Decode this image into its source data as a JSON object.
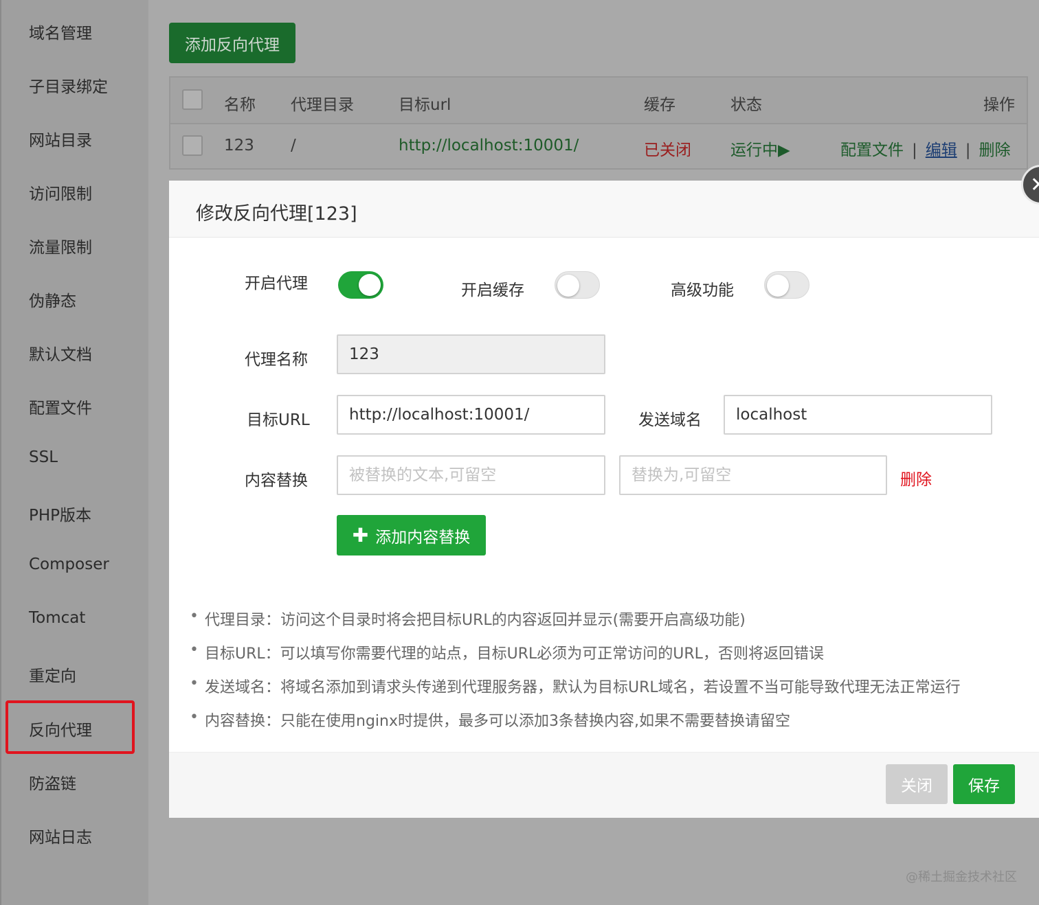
{
  "sidebar": {
    "items": [
      "域名管理",
      "子目录绑定",
      "网站目录",
      "访问限制",
      "流量限制",
      "伪静态",
      "默认文档",
      "配置文件",
      "SSL",
      "PHP版本",
      "Composer",
      "Tomcat",
      "重定向",
      "反向代理",
      "防盗链",
      "网站日志"
    ],
    "active": "反向代理"
  },
  "toolbar": {
    "add_proxy_label": "添加反向代理"
  },
  "table": {
    "headers": {
      "name": "名称",
      "dir": "代理目录",
      "url": "目标url",
      "cache": "缓存",
      "status": "状态",
      "ops": "操作"
    },
    "rows": [
      {
        "name": "123",
        "dir": "/",
        "url": "http://localhost:10001/",
        "cache": "已关闭",
        "status": "运行中▶",
        "op_config": "配置文件",
        "op_edit": "编辑",
        "op_delete": "删除",
        "separator": "|"
      }
    ]
  },
  "modal": {
    "title": "修改反向代理[123]",
    "close_icon": "close-icon",
    "toggles": {
      "proxy_label": "开启代理",
      "proxy_on": true,
      "cache_label": "开启缓存",
      "cache_on": false,
      "advanced_label": "高级功能",
      "advanced_on": false
    },
    "fields": {
      "name_label": "代理名称",
      "name_value": "123",
      "target_label": "目标URL",
      "target_value": "http://localhost:10001/",
      "domain_label": "发送域名",
      "domain_value": "localhost",
      "replace_label": "内容替换",
      "replace_from_placeholder": "被替换的文本,可留空",
      "replace_to_placeholder": "替换为,可留空",
      "replace_delete": "删除"
    },
    "add_content_label": "添加内容替换",
    "tips": [
      "代理目录：访问这个目录时将会把目标URL的内容返回并显示(需要开启高级功能)",
      "目标URL：可以填写你需要代理的站点，目标URL必须为可正常访问的URL，否则将返回错误",
      "发送域名：将域名添加到请求头传递到代理服务器，默认为目标URL域名，若设置不当可能导致代理无法正常运行",
      "内容替换：只能在使用nginx时提供，最多可以添加3条替换内容,如果不需要替换请留空"
    ],
    "bullet": "•",
    "footer": {
      "close_label": "关闭",
      "save_label": "保存"
    }
  },
  "watermark": "@稀土掘金技术社区",
  "colors": {
    "accent": "#20a53a",
    "danger": "#e0141e",
    "overlay": "#a9a9a9"
  }
}
